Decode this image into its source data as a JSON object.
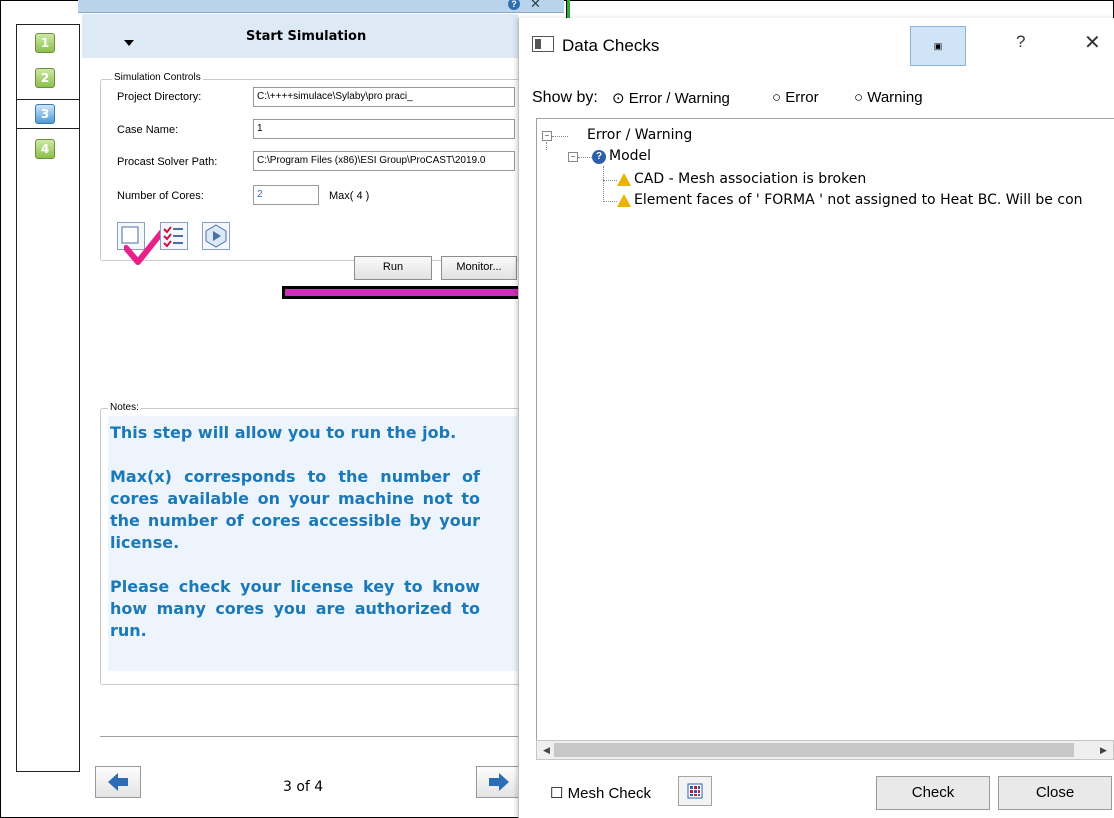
{
  "steps": [
    "1",
    "2",
    "3",
    "4"
  ],
  "header": {
    "title": "Start Simulation"
  },
  "simulation_controls": {
    "legend": "Simulation Controls",
    "project_directory_label": "Project Directory:",
    "project_directory_value": "C:\\++++simulace\\Sylaby\\pro praci_",
    "case_name_label": "Case Name:",
    "case_name_value": "1",
    "solver_path_label": "Procast Solver Path:",
    "solver_path_value": "C:\\Program Files (x86)\\ESI Group\\ProCAST\\2019.0",
    "cores_label": "Number of Cores:",
    "cores_value": "2",
    "cores_max": "Max( 4 )",
    "run_label": "Run",
    "monitor_label": "Monitor..."
  },
  "notes": {
    "legend": "Notes:",
    "paragraphs": [
      "This step will allow you to run the job.",
      "Max(x) corresponds to the number of cores available on your machine not to the number of cores accessible by your license.",
      "Please check your license key to know how many cores you are authorized to run."
    ]
  },
  "pager": {
    "indicator": "3 of 4"
  },
  "dialog": {
    "title": "Data Checks",
    "restore_glyph": "▣",
    "help_glyph": "?",
    "close_glyph": "✕",
    "show_by_label": "Show by:",
    "filters": [
      {
        "label": "Error / Warning",
        "selected": true
      },
      {
        "label": "Error",
        "selected": false
      },
      {
        "label": "Warning",
        "selected": false
      }
    ],
    "tree": {
      "root": "Error / Warning",
      "model": "Model",
      "items": [
        "CAD - Mesh association is broken",
        "Element faces of ' FORMA ' not assigned to Heat BC. Will be con"
      ]
    },
    "mesh_check_label": "Mesh Check",
    "check_label": "Check",
    "close_label": "Close"
  },
  "colors": {
    "accent_blue": "#1a79b8",
    "header_bg": "#ddeaf6",
    "arrow_fill": "#ce2fb8",
    "warning": "#e8b400",
    "check_mark": "#e8208a"
  },
  "icons": [
    "help-icon",
    "close-icon",
    "data-check-icon",
    "checklist-icon",
    "solver-icon",
    "prev-arrow-icon",
    "next-arrow-icon",
    "warning-icon",
    "model-icon",
    "grid-icon"
  ]
}
